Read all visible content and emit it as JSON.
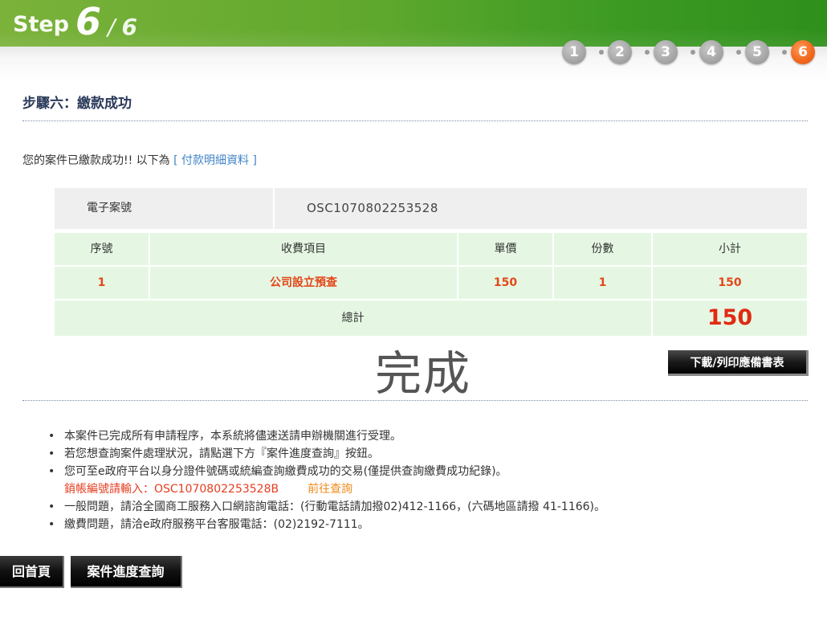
{
  "header": {
    "step_word": "Step",
    "step_current": "6",
    "step_slash": "/",
    "step_total": "6"
  },
  "progress": {
    "steps": [
      "1",
      "2",
      "3",
      "4",
      "5",
      "6"
    ],
    "active_index": 5,
    "colors": {
      "active": "#f26a1f",
      "inactive": "#a9a9a9"
    }
  },
  "section_title": "步驟六：繳款成功",
  "intro": {
    "text": "您的案件已繳款成功!! 以下為",
    "link": "[ 付款明細資料 ]"
  },
  "table": {
    "case_label": "電子案號",
    "case_value": "OSC1070802253528",
    "headers": [
      "序號",
      "收費項目",
      "單價",
      "份數",
      "小計"
    ],
    "rows": [
      [
        "1",
        "公司設立預查",
        "150",
        "1",
        "150"
      ]
    ],
    "total_label": "總計",
    "total_value": "150"
  },
  "complete_text": "完成",
  "download_button": "下載/列印應備書表",
  "notes": [
    "本案件已完成所有申請程序，本系統將儘速送請申辦機關進行受理。",
    "若您想查詢案件處理狀況，請點選下方『案件進度查詢』按鈕。",
    "您可至e政府平台以身分證件號碼或統編查詢繳費成功的交易(僅提供查詢繳費成功紀錄)。",
    "一般問題，請洽全國商工服務入口網諮詢電話：(行動電話請加撥02)412-1166，(六碼地區請撥 41-1166)。",
    "繳費問題，請洽e政府服務平台客服電話：(02)2192-7111。"
  ],
  "cancel_note": {
    "text": "銷帳編號請輸入：OSC1070802253528B",
    "link": "前往查詢"
  },
  "buttons": {
    "home": "回首頁",
    "progress_query": "案件進度查詢"
  }
}
